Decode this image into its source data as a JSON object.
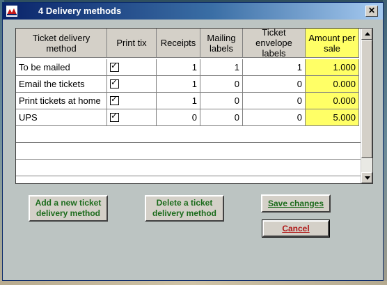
{
  "window": {
    "title": "4 Delivery methods",
    "close_glyph": "✕"
  },
  "table": {
    "columns": [
      "Ticket delivery method",
      "Print tix",
      "Receipts",
      "Mailing labels",
      "Ticket envelope labels",
      "Amount per sale"
    ],
    "rows": [
      {
        "method": "To be mailed",
        "print_tix": true,
        "receipts": "1",
        "mailing": "1",
        "envelope": "1",
        "amount": "1.000"
      },
      {
        "method": "Email the tickets",
        "print_tix": true,
        "receipts": "1",
        "mailing": "0",
        "envelope": "0",
        "amount": "0.000"
      },
      {
        "method": "Print tickets at home",
        "print_tix": true,
        "receipts": "1",
        "mailing": "0",
        "envelope": "0",
        "amount": "0.000"
      },
      {
        "method": "UPS",
        "print_tix": true,
        "receipts": "0",
        "mailing": "0",
        "envelope": "0",
        "amount": "5.000"
      }
    ]
  },
  "buttons": {
    "add": "Add a new ticket delivery method",
    "delete": "Delete a ticket delivery method",
    "save": "Save changes",
    "cancel": "Cancel"
  },
  "colors": {
    "title_bar": "#0a246a",
    "highlight_column": "#ffff66",
    "button_text": "#1b6b1b",
    "cancel_text": "#b01818"
  }
}
